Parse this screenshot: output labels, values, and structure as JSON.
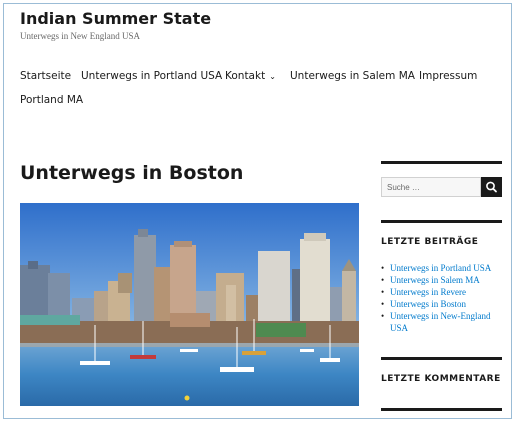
{
  "site": {
    "title": "Indian Summer State",
    "description": "Unterwegs in New England USA"
  },
  "nav": {
    "items": [
      {
        "label": "Startseite"
      },
      {
        "label": "Unterwegs in Portland USA"
      },
      {
        "label": "Kontakt",
        "caret": "⌄"
      },
      {
        "label": "Unterwegs in Salem MA"
      },
      {
        "label": "Impressum"
      },
      {
        "label": "Portland MA"
      }
    ]
  },
  "main": {
    "entry_title": "Unterwegs in Boston"
  },
  "sidebar": {
    "search_placeholder": "Suche …",
    "recent_posts_title": "LETZTE BEITRÄGE",
    "recent_posts": [
      "Unterwegs in Portland USA",
      "Unterwegs in Salem MA",
      "Unterwegs in Revere",
      "Unterwegs in Boston",
      "Unterwegs in New-England USA"
    ],
    "recent_comments_title": "LETZTE KOMMENTARE"
  },
  "icons": {
    "search_button": "search-icon",
    "dropdown": "chevron-down-icon"
  },
  "colors": {
    "link": "#007acc",
    "text": "#1a1a1a",
    "frame_border": "#9bbcd6",
    "sky": "#3a7fd0",
    "water": "#4a90c8"
  }
}
